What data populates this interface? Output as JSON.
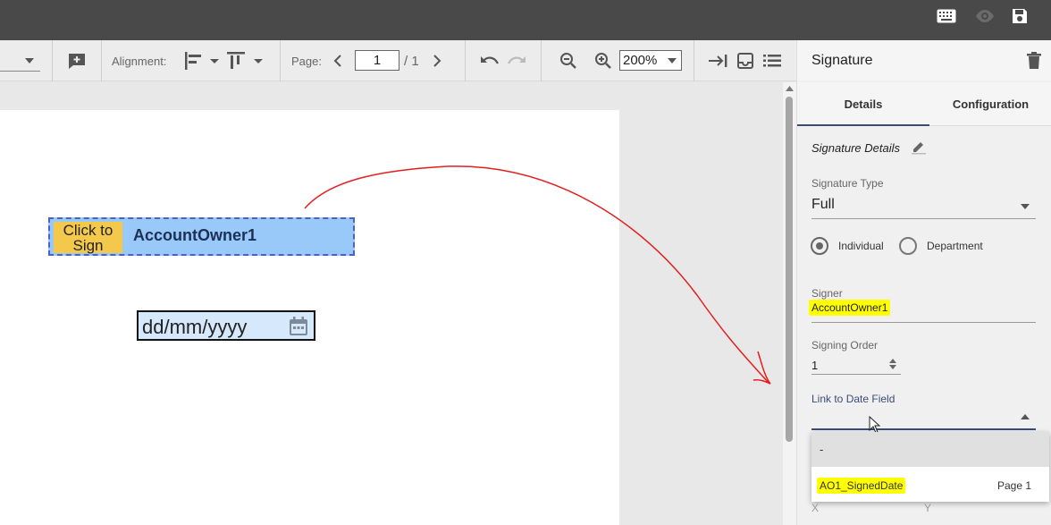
{
  "topbar": {
    "icons": [
      "keyboard-icon",
      "eye-icon",
      "save-icon"
    ]
  },
  "toolbar": {
    "alignment_label": "Alignment:",
    "page_label": "Page:",
    "page_value": "1",
    "page_total": "/ 1",
    "zoom_value": "200%"
  },
  "document": {
    "sign_button": "Click to Sign",
    "signer_name": "AccountOwner1",
    "date_placeholder": "dd/mm/yyyy"
  },
  "panel": {
    "title": "Signature",
    "tabs": [
      {
        "label": "Details",
        "active": true
      },
      {
        "label": "Configuration",
        "active": false
      }
    ],
    "section_title": "Signature Details",
    "signature_type_label": "Signature Type",
    "signature_type_value": "Full",
    "radio_options": [
      {
        "label": "Individual",
        "selected": true
      },
      {
        "label": "Department",
        "selected": false
      }
    ],
    "signer_label": "Signer",
    "signer_value": "AccountOwner1",
    "signing_order_label": "Signing Order",
    "signing_order_value": "1",
    "link_label": "Link to Date Field",
    "dropdown_options": [
      {
        "label": "-",
        "page": ""
      },
      {
        "label": "AO1_SignedDate",
        "page": "Page 1"
      }
    ],
    "x_label": "X",
    "y_label": "Y"
  },
  "colors": {
    "accent": "#3a4b7a",
    "highlight": "#ffff00",
    "sign_button": "#f4c94b",
    "sign_field": "#99c9f9",
    "annotation_arrow": "#e41e1e"
  }
}
